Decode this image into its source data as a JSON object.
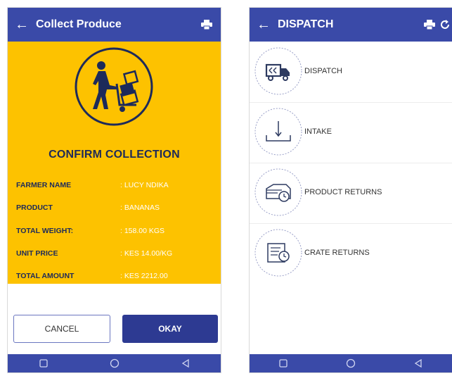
{
  "left_screen": {
    "appbar": {
      "title": "Collect Produce",
      "back_icon": "arrow-left-icon",
      "action_icon": "printer-icon"
    },
    "hero_icon": "person-pushing-cart-icon",
    "heading": "CONFIRM COLLECTION",
    "fields": [
      {
        "label": "FARMER NAME",
        "value": ": LUCY NDIKA"
      },
      {
        "label": "PRODUCT",
        "value": ": BANANAS"
      },
      {
        "label": "TOTAL WEIGHT:",
        "value": ": 158.00 KGS"
      },
      {
        "label": "UNIT PRICE",
        "value": ": KES 14.00/KG"
      },
      {
        "label": "TOTAL AMOUNT",
        "value": ": KES 2212.00"
      }
    ],
    "buttons": {
      "cancel": "CANCEL",
      "okay": "OKAY"
    }
  },
  "right_screen": {
    "appbar": {
      "title": "DISPATCH",
      "back_icon": "arrow-left-icon",
      "action_icons": [
        "printer-icon",
        "refresh-icon"
      ]
    },
    "menu": [
      {
        "label": "DISPATCH",
        "icon": "truck-icon"
      },
      {
        "label": "INTAKE",
        "icon": "intake-tray-icon"
      },
      {
        "label": "PRODUCT RETURNS",
        "icon": "product-returns-icon"
      },
      {
        "label": "CRATE RETURNS",
        "icon": "crate-returns-icon"
      }
    ]
  },
  "system_nav": [
    "square-nav-icon",
    "circle-nav-icon",
    "triangle-back-nav-icon"
  ],
  "colors": {
    "primary": "#3a4aa8",
    "accent_yellow": "#fdc200",
    "dark_navy": "#1d2a5a",
    "button_dark": "#2d3a92"
  }
}
